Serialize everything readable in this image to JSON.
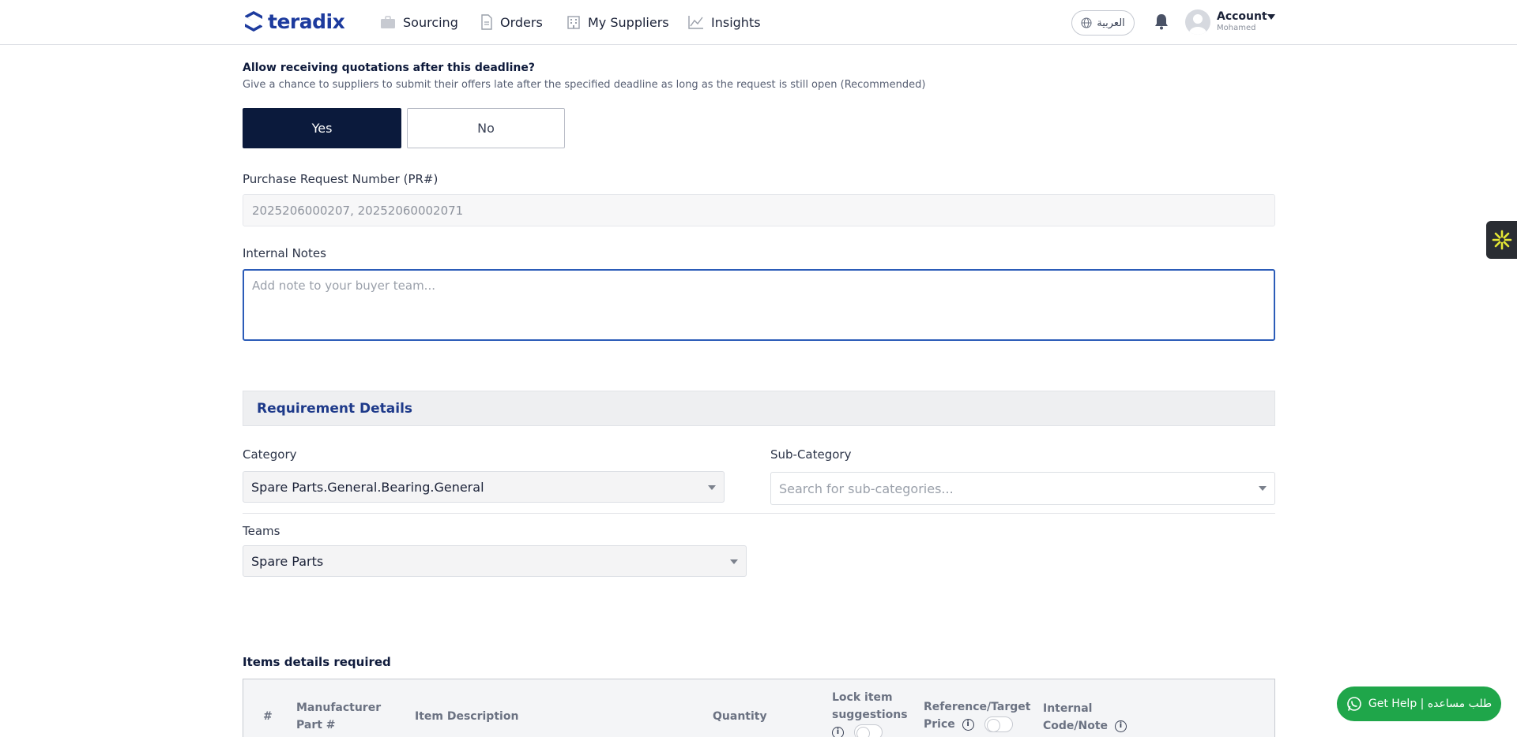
{
  "nav": {
    "brand": "teradix",
    "items": [
      {
        "label": "Sourcing",
        "icon": "briefcase-icon"
      },
      {
        "label": "Orders",
        "icon": "document-icon"
      },
      {
        "label": "My Suppliers",
        "icon": "building-icon"
      },
      {
        "label": "Insights",
        "icon": "chart-icon"
      }
    ],
    "language": "العربية",
    "account": {
      "label": "Account",
      "sub": "Mohamed"
    }
  },
  "deadline": {
    "question": "Allow receiving quotations after this deadline?",
    "help": "Give a chance to suppliers to submit their offers late after the specified deadline as long as the request is still open (Recommended)",
    "yes": "Yes",
    "no": "No",
    "selected": "Yes"
  },
  "pr": {
    "label": "Purchase Request Number (PR#)",
    "value": "2025206000207, 20252060002071"
  },
  "notes": {
    "label": "Internal Notes",
    "placeholder": "Add note to your buyer team..."
  },
  "requirements": {
    "title": "Requirement Details",
    "category_label": "Category",
    "category_value": "Spare Parts.General.Bearing.General",
    "subcategory_label": "Sub-Category",
    "subcategory_placeholder": "Search for sub-categories...",
    "teams_label": "Teams",
    "teams_value": "Spare Parts"
  },
  "items": {
    "title": "Items details required",
    "headers": {
      "num": "#",
      "mpn": "Manufacturer Part #",
      "desc": "Item Description",
      "qty": "Quantity",
      "lock": "Lock item suggestions",
      "price": "Reference/Target Price",
      "code": "Internal Code/Note"
    }
  },
  "help_button": "Get Help | طلب مساعده",
  "colors": {
    "brand": "#1d3b9e",
    "primary_dark": "#0b1a3c",
    "section_title": "#1e3a8a",
    "help_green": "#1fa64a",
    "focus_border": "#2c5cb8"
  }
}
